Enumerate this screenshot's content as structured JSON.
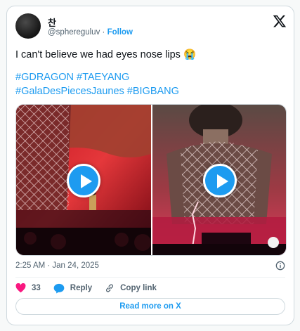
{
  "author": {
    "display_name": "찬",
    "handle": "@sphereguluv",
    "separator": "·",
    "follow_label": "Follow"
  },
  "tweet": {
    "text": "I can't believe we had eyes nose lips 😭",
    "hashtag_line_1": [
      "#GDRAGON",
      "#TAEYANG"
    ],
    "hashtag_line_2": [
      "#GalaDesPiecesJaunes",
      "#BIGBANG"
    ]
  },
  "meta": {
    "timestamp": "2:25 AM · Jan 24, 2025"
  },
  "actions": {
    "like_count": "33",
    "reply_label": "Reply",
    "copy_link_label": "Copy link"
  },
  "read_more_label": "Read more on X",
  "icons": [
    "x-logo-icon",
    "play-icon",
    "info-icon",
    "heart-icon",
    "reply-bubble-icon",
    "link-icon"
  ],
  "colors": {
    "accent": "#1d9bf0",
    "like": "#f91880",
    "muted_text": "#536471",
    "border": "#cfd9de"
  }
}
